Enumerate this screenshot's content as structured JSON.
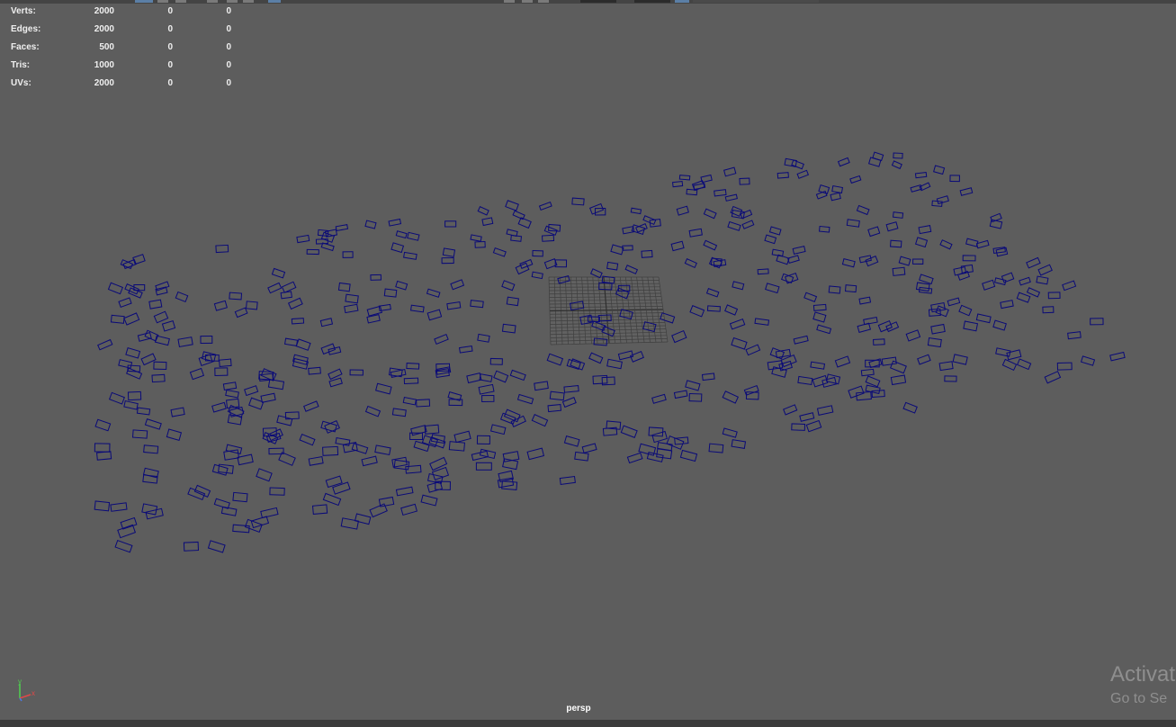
{
  "hud": {
    "rows": [
      {
        "label": "Verts:",
        "values": [
          "2000",
          "0",
          "0"
        ]
      },
      {
        "label": "Edges:",
        "values": [
          "2000",
          "0",
          "0"
        ]
      },
      {
        "label": "Faces:",
        "values": [
          "500",
          "0",
          "0"
        ]
      },
      {
        "label": "Tris:",
        "values": [
          "1000",
          "0",
          "0"
        ]
      },
      {
        "label": "UVs:",
        "values": [
          "2000",
          "0",
          "0"
        ]
      }
    ]
  },
  "viewport": {
    "camera": "persp",
    "axis_labels": {
      "x": "x",
      "y": "y",
      "z": "z"
    }
  },
  "colors": {
    "background": "#5d5d5d",
    "planes": "#0a0a78",
    "grid": "#3f3f3f"
  },
  "watermark": {
    "title": "Activat",
    "subtitle": "Go to Se"
  }
}
